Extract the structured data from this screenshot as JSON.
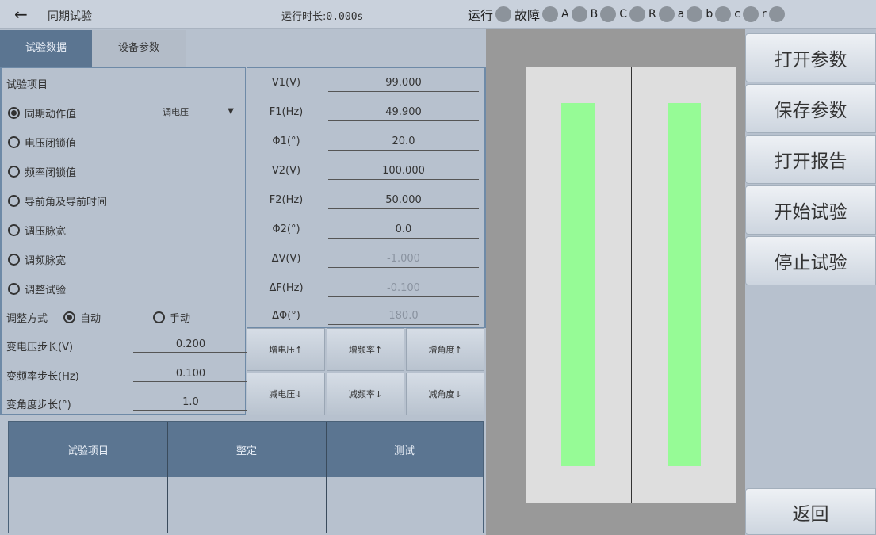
{
  "header": {
    "back_icon": "arrow-left-icon",
    "title": "同期试验",
    "runtime_label": "运行时长:",
    "runtime_value": "0.000s",
    "indicators": [
      {
        "label": "运行",
        "color": "#8c939b"
      },
      {
        "label": "故障",
        "color": "#8c939b"
      },
      {
        "label": "A",
        "color": "#8c939b"
      },
      {
        "label": "B",
        "color": "#8c939b"
      },
      {
        "label": "C",
        "color": "#8c939b"
      },
      {
        "label": "R",
        "color": "#8c939b"
      },
      {
        "label": "a",
        "color": "#8c939b"
      },
      {
        "label": "b",
        "color": "#8c939b"
      },
      {
        "label": "c",
        "color": "#8c939b"
      },
      {
        "label": "r",
        "color": "#8c939b"
      }
    ]
  },
  "tabs": [
    {
      "label": "试验数据",
      "active": true
    },
    {
      "label": "设备参数",
      "active": false
    }
  ],
  "test_items": {
    "heading": "试验项目",
    "options": [
      {
        "label": "同期动作值",
        "selected": true
      },
      {
        "label": "电压闭锁值",
        "selected": false
      },
      {
        "label": "频率闭锁值",
        "selected": false
      },
      {
        "label": "导前角及导前时间",
        "selected": false
      },
      {
        "label": "调压脉宽",
        "selected": false
      },
      {
        "label": "调频脉宽",
        "selected": false
      },
      {
        "label": "调整试验",
        "selected": false
      }
    ],
    "dropdown_value": "调电压"
  },
  "adjust": {
    "label": "调整方式",
    "auto_label": "自动",
    "manual_label": "手动",
    "auto_selected": true
  },
  "steps": [
    {
      "label": "变电压步长(V)",
      "value": "0.200"
    },
    {
      "label": "变频率步长(Hz)",
      "value": "0.100"
    },
    {
      "label": "变角度步长(°)",
      "value": "1.0"
    }
  ],
  "params": [
    {
      "label": "V1(V)",
      "value": "99.000",
      "dim": false
    },
    {
      "label": "F1(Hz)",
      "value": "49.900",
      "dim": false
    },
    {
      "label": "Φ1(°)",
      "value": "20.0",
      "dim": false
    },
    {
      "label": "V2(V)",
      "value": "100.000",
      "dim": false
    },
    {
      "label": "F2(Hz)",
      "value": "50.000",
      "dim": false
    },
    {
      "label": "Φ2(°)",
      "value": "0.0",
      "dim": false
    },
    {
      "label": "ΔV(V)",
      "value": "-1.000",
      "dim": true
    },
    {
      "label": "ΔF(Hz)",
      "value": "-0.100",
      "dim": true
    },
    {
      "label": "ΔΦ(°)",
      "value": "180.0",
      "dim": true
    }
  ],
  "step_buttons": [
    "增电压↑",
    "增频率↑",
    "增角度↑",
    "减电压↓",
    "减频率↓",
    "减角度↓"
  ],
  "result_table": {
    "headers": [
      "试验项目",
      "整定",
      "测试"
    ]
  },
  "display": {
    "bar_color": "#96fb96",
    "background": "#dedede"
  },
  "actions": {
    "open_params": "打开参数",
    "save_params": "保存参数",
    "open_report": "打开报告",
    "start_test": "开始试验",
    "stop_test": "停止试验",
    "back": "返回"
  }
}
